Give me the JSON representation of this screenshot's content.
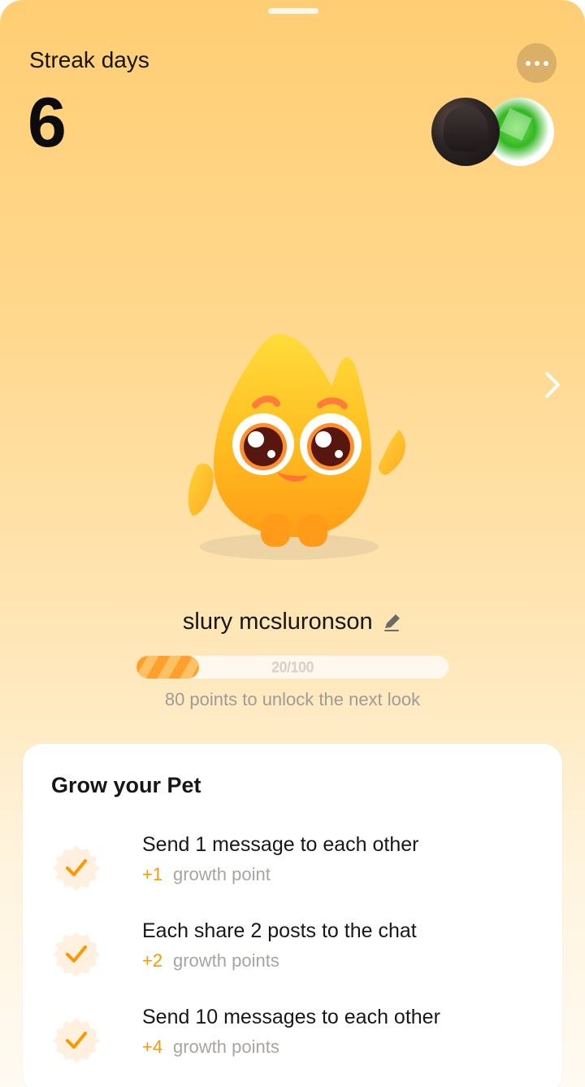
{
  "header": {
    "streak_label": "Streak days",
    "streak_count": "6"
  },
  "icons": {
    "more": "more-icon",
    "next": "chevron-right-icon",
    "edit": "pencil-icon",
    "check": "check-badge-icon"
  },
  "avatars": [
    {
      "name": "user-avatar-a"
    },
    {
      "name": "user-avatar-b"
    }
  ],
  "pet": {
    "name": "slury mcsluronson",
    "progress_text": "20/100",
    "progress_fraction": 0.2,
    "unlock_text": "80 points to unlock the next look"
  },
  "grow": {
    "title": "Grow your Pet",
    "tasks": [
      {
        "title": "Send 1 message to each other",
        "points": "+1",
        "points_label": "growth point"
      },
      {
        "title": "Each share 2 posts to the chat",
        "points": "+2",
        "points_label": "growth points"
      },
      {
        "title": "Send 10 messages to each other",
        "points": "+4",
        "points_label": "growth points"
      }
    ]
  },
  "colors": {
    "accent_orange": "#ff9700",
    "background_top": "#ffce74",
    "background_bottom": "#fffaf2"
  }
}
